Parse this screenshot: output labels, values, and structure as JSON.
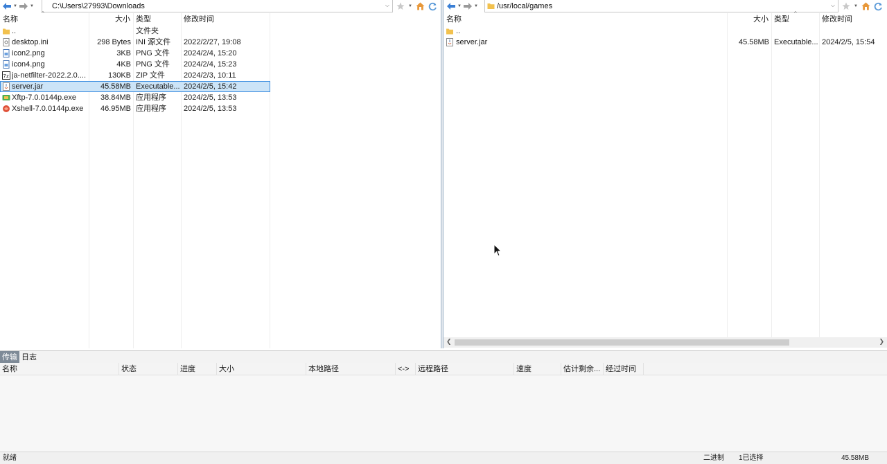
{
  "left": {
    "path": "C:\\Users\\27993\\Downloads",
    "columns": [
      "名称",
      "大小",
      "类型",
      "修改时间"
    ],
    "rows": [
      {
        "name": "..",
        "size": "",
        "type": "文件夹",
        "modified": "",
        "icon": "folder-icon"
      },
      {
        "name": "desktop.ini",
        "size": "298 Bytes",
        "type": "INI 源文件",
        "modified": "2022/2/27, 19:08",
        "icon": "settings-file-icon"
      },
      {
        "name": "icon2.png",
        "size": "3KB",
        "type": "PNG 文件",
        "modified": "2024/2/4, 15:20",
        "icon": "image-file-icon"
      },
      {
        "name": "icon4.png",
        "size": "4KB",
        "type": "PNG 文件",
        "modified": "2024/2/4, 15:23",
        "icon": "image-file-icon"
      },
      {
        "name": "ja-netfilter-2022.2.0....",
        "size": "130KB",
        "type": "ZIP 文件",
        "modified": "2024/2/3, 10:11",
        "icon": "zip-file-icon"
      },
      {
        "name": "server.jar",
        "size": "45.58MB",
        "type": "Executable...",
        "modified": "2024/2/5, 15:42",
        "icon": "jar-file-icon",
        "selected": true
      },
      {
        "name": "Xftp-7.0.0144p.exe",
        "size": "38.84MB",
        "type": "应用程序",
        "modified": "2024/2/5, 13:53",
        "icon": "xftp-app-icon"
      },
      {
        "name": "Xshell-7.0.0144p.exe",
        "size": "46.95MB",
        "type": "应用程序",
        "modified": "2024/2/5, 13:53",
        "icon": "xshell-app-icon"
      }
    ]
  },
  "right": {
    "path": "/usr/local/games",
    "columns": [
      "名称",
      "大小",
      "类型",
      "修改时间"
    ],
    "rows": [
      {
        "name": "..",
        "size": "",
        "type": "",
        "modified": "",
        "icon": "folder-icon"
      },
      {
        "name": "server.jar",
        "size": "45.58MB",
        "type": "Executable...",
        "modified": "2024/2/5, 15:54",
        "icon": "jar-file-icon"
      }
    ]
  },
  "transfer": {
    "tabs": [
      "传输",
      "日志"
    ],
    "active_tab": 0,
    "columns": [
      "名称",
      "状态",
      "进度",
      "大小",
      "本地路径",
      "<->",
      "远程路径",
      "速度",
      "估计剩余...",
      "经过时间"
    ]
  },
  "status": {
    "ready": "就绪",
    "mode": "二进制",
    "selected": "1已选择",
    "size": "45.58MB"
  },
  "colors": {
    "selection_bg": "#cce4f7",
    "selection_border": "#3d8ee0",
    "nav_arrow": "#3a7fd5",
    "tab_active_bg": "#7e8a97"
  }
}
